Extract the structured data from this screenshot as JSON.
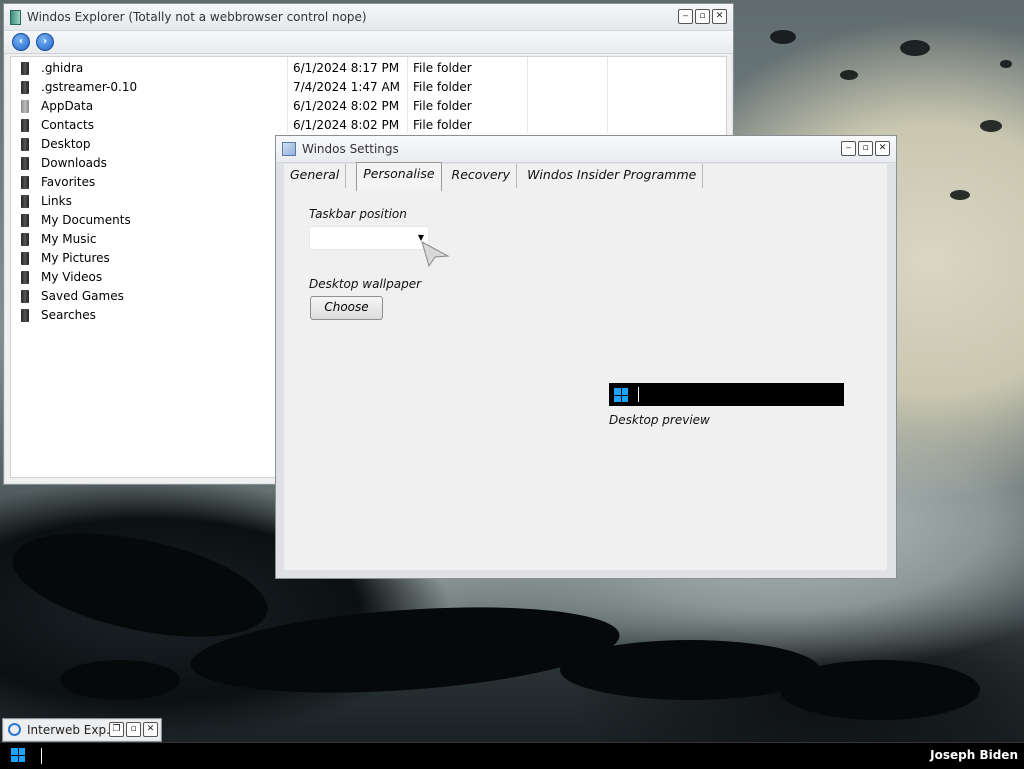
{
  "explorer": {
    "title": "Windos Explorer (Totally not a webbrowser control nope)",
    "nav": {
      "back_icon": "back-arrow-icon",
      "forward_icon": "forward-arrow-icon"
    },
    "files": [
      {
        "name": ".ghidra",
        "date": "6/1/2024 8:17 PM",
        "type": "File folder"
      },
      {
        "name": ".gstreamer-0.10",
        "date": "7/4/2024 1:47 AM",
        "type": "File folder"
      },
      {
        "name": "AppData",
        "date": "6/1/2024 8:02 PM",
        "type": "File folder"
      },
      {
        "name": "Contacts",
        "date": "6/1/2024 8:02 PM",
        "type": "File folder"
      },
      {
        "name": "Desktop",
        "date": "",
        "type": ""
      },
      {
        "name": "Downloads",
        "date": "",
        "type": ""
      },
      {
        "name": "Favorites",
        "date": "",
        "type": ""
      },
      {
        "name": "Links",
        "date": "",
        "type": ""
      },
      {
        "name": "My Documents",
        "date": "",
        "type": ""
      },
      {
        "name": "My Music",
        "date": "",
        "type": ""
      },
      {
        "name": "My Pictures",
        "date": "",
        "type": ""
      },
      {
        "name": "My Videos",
        "date": "",
        "type": ""
      },
      {
        "name": "Saved Games",
        "date": "",
        "type": ""
      },
      {
        "name": "Searches",
        "date": "",
        "type": ""
      }
    ]
  },
  "settings": {
    "title": "Windos Settings",
    "tabs": [
      "General",
      "Personalise",
      "Recovery",
      "Windos Insider Programme"
    ],
    "active_tab": "Personalise",
    "taskbar_position_label": "Taskbar position",
    "taskbar_position_value": "",
    "wallpaper_label": "Desktop wallpaper",
    "choose_button": "Choose",
    "preview_label": "Desktop preview"
  },
  "minimized": {
    "title": "Interweb Exp..."
  },
  "taskbar": {
    "user": "Joseph Biden"
  },
  "colors": {
    "accent": "#1aa3ff",
    "taskbar": "#000000"
  }
}
